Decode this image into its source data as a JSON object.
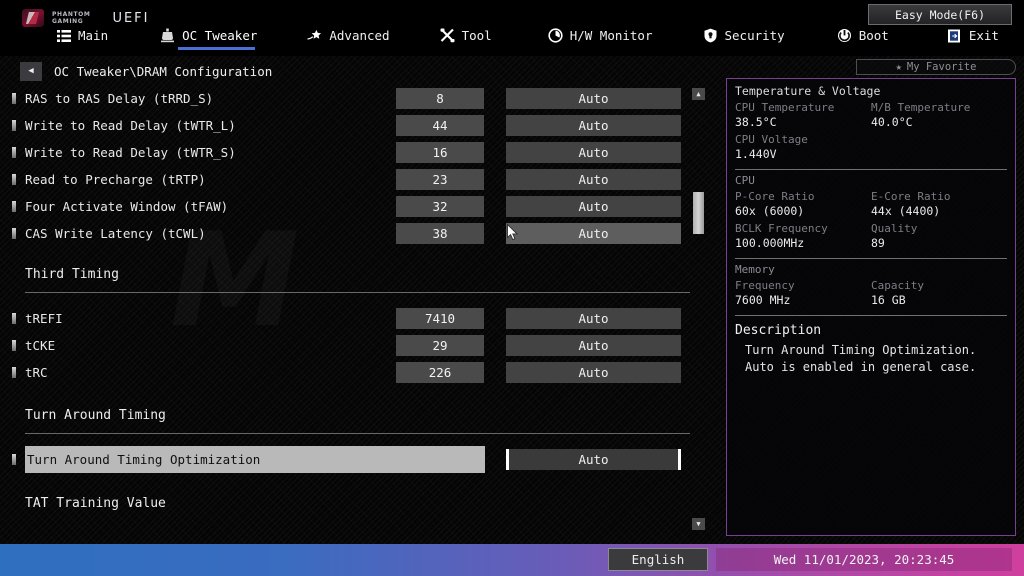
{
  "header": {
    "brand_line1": "PHANTOM",
    "brand_line2": "GAMING",
    "uefi": "UEFI",
    "easy_mode_label": "Easy Mode(F6)",
    "my_favorite_label": "My Favorite",
    "my_favorite_icon": "star-icon",
    "tabs": [
      {
        "label": "Main",
        "icon": "list-icon",
        "active": false
      },
      {
        "label": "OC Tweaker",
        "icon": "oc-tweaker-icon",
        "active": true
      },
      {
        "label": "Advanced",
        "icon": "advanced-star-icon",
        "active": false
      },
      {
        "label": "Tool",
        "icon": "wrench-icon",
        "active": false
      },
      {
        "label": "H/W Monitor",
        "icon": "gauge-icon",
        "active": false
      },
      {
        "label": "Security",
        "icon": "shield-icon",
        "active": false
      },
      {
        "label": "Boot",
        "icon": "power-icon",
        "active": false
      },
      {
        "label": "Exit",
        "icon": "exit-door-icon",
        "active": false
      }
    ]
  },
  "breadcrumb": {
    "back_icon": "back-arrow-icon",
    "path": "OC Tweaker\\DRAM Configuration"
  },
  "main": {
    "rows": [
      {
        "label": "RAS to RAS Delay (tRRD_S)",
        "value": "8",
        "option": "Auto"
      },
      {
        "label": "Write to Read Delay (tWTR_L)",
        "value": "44",
        "option": "Auto"
      },
      {
        "label": "Write to Read Delay (tWTR_S)",
        "value": "16",
        "option": "Auto"
      },
      {
        "label": "Read to Precharge (tRTP)",
        "value": "23",
        "option": "Auto"
      },
      {
        "label": "Four Activate Window (tFAW)",
        "value": "32",
        "option": "Auto"
      },
      {
        "label": "CAS Write Latency (tCWL)",
        "value": "38",
        "option": "Auto"
      }
    ],
    "section_third": "Third Timing",
    "rows_third": [
      {
        "label": "tREFI",
        "value": "7410",
        "option": "Auto"
      },
      {
        "label": "tCKE",
        "value": "29",
        "option": "Auto"
      },
      {
        "label": "tRC",
        "value": "226",
        "option": "Auto"
      }
    ],
    "section_turn": "Turn Around Timing",
    "selected_row": {
      "label": "Turn Around Timing Optimization",
      "option": "Auto"
    },
    "section_tat": "TAT Training Value"
  },
  "panel": {
    "temp_volt_title": "Temperature & Voltage",
    "cpu_temp_key": "CPU Temperature",
    "cpu_temp_val": "38.5°C",
    "mb_temp_key": "M/B Temperature",
    "mb_temp_val": "40.0°C",
    "cpu_voltage_key": "CPU Voltage",
    "cpu_voltage_val": "1.440V",
    "cpu_title": "CPU",
    "pcore_key": "P-Core Ratio",
    "pcore_val": "60x (6000)",
    "ecore_key": "E-Core Ratio",
    "ecore_val": "44x (4400)",
    "bclk_key": "BCLK Frequency",
    "bclk_val": "100.000MHz",
    "quality_key": "Quality",
    "quality_val": "89",
    "memory_title": "Memory",
    "freq_key": "Frequency",
    "freq_val": "7600 MHz",
    "cap_key": "Capacity",
    "cap_val": "16 GB",
    "description_title": "Description",
    "description_line1": "Turn Around Timing Optimization.",
    "description_line2": "Auto is enabled in general case."
  },
  "footer": {
    "language": "English",
    "datetime": "Wed 11/01/2023, 20:23:45"
  },
  "colors": {
    "accent_blue": "#4a6fd6",
    "panel_border": "#7a3f8f",
    "highlight_bg": "#b9b9b9",
    "footer_start": "#2f6fc0",
    "footer_end": "#cf3f9e"
  },
  "watermark": "M"
}
